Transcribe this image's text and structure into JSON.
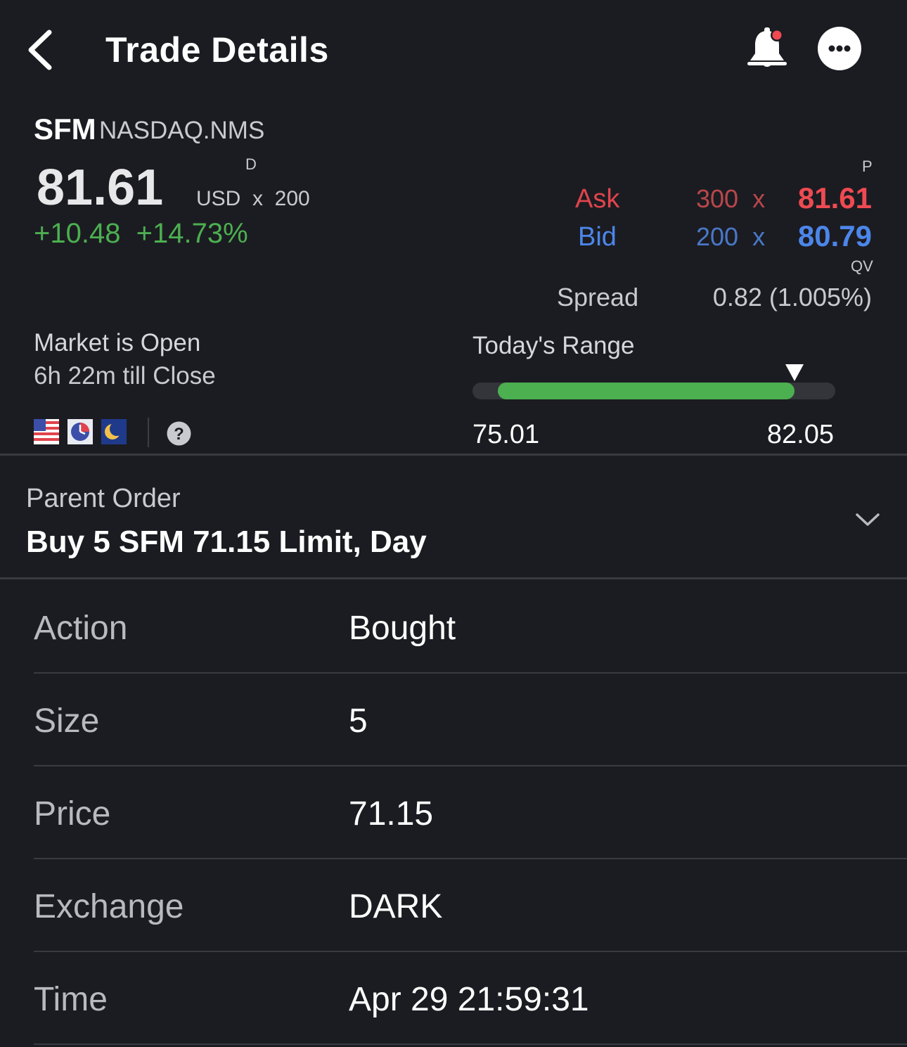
{
  "header": {
    "title": "Trade Details",
    "icons": {
      "back": "chevron-left-icon",
      "alert": "bell-icon",
      "more": "more-horizontal-icon"
    },
    "alert_badge_color": "#ef4a52"
  },
  "quote": {
    "symbol": "SFM",
    "exchange": "NASDAQ.NMS",
    "last_price": "81.61",
    "last_flag": "D",
    "currency_size": "USD  x  200",
    "change": "+10.48  +14.73%",
    "ask": {
      "label": "Ask",
      "size": "300  x",
      "price": "81.61",
      "flag": "P"
    },
    "bid": {
      "label": "Bid",
      "size": "200  x",
      "price": "80.79"
    },
    "quote_flag": "QV",
    "spread": {
      "label": "Spread",
      "value": "0.82 (1.005%)"
    },
    "colors": {
      "up": "#4caf50",
      "ask": "#ef4a52",
      "bid": "#4c86ea"
    }
  },
  "market": {
    "status": "Market is Open",
    "countdown": "6h 22m till Close",
    "session_icons": [
      "us-flag-icon",
      "clock-icon",
      "moon-icon",
      "help-icon"
    ]
  },
  "todays_range": {
    "title": "Today's Range",
    "low": "75.01",
    "high": "82.05",
    "current": 81.61,
    "low_value": 75.01,
    "high_value": 82.05
  },
  "parent_order": {
    "label": "Parent Order",
    "value": "Buy 5 SFM 71.15 Limit, Day"
  },
  "details": [
    {
      "label": "Action",
      "value": "Bought"
    },
    {
      "label": "Size",
      "value": "5"
    },
    {
      "label": "Price",
      "value": "71.15"
    },
    {
      "label": "Exchange",
      "value": "DARK"
    },
    {
      "label": "Time",
      "value": "Apr 29 21:59:31"
    }
  ]
}
